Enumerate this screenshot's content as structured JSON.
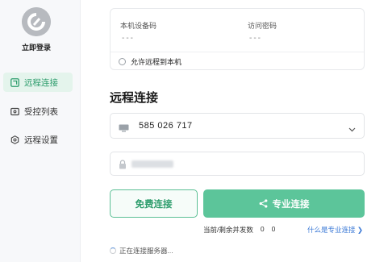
{
  "sidebar": {
    "login_label": "立即登录",
    "items": [
      {
        "label": "远程连接",
        "icon": "remote-connect-icon",
        "active": true
      },
      {
        "label": "受控列表",
        "icon": "controlled-list-icon",
        "active": false
      },
      {
        "label": "远程设置",
        "icon": "settings-icon",
        "active": false
      }
    ]
  },
  "device_card": {
    "device_code_label": "本机设备码",
    "device_code_value": "---",
    "access_password_label": "访问密码",
    "access_password_value": "---",
    "allow_remote_label": "允许远程到本机"
  },
  "main": {
    "title": "远程连接",
    "remote_id": "585 026 717",
    "free_connect_label": "免费连接",
    "pro_connect_label": "专业连接",
    "concurrency_label": "当前/剩余并发数",
    "concurrency_current": "0",
    "concurrency_remaining": "0",
    "pro_link_label": "什么是专业连接 ❯",
    "status_text": "正在连接服务器..."
  },
  "colors": {
    "accent": "#5cc59a",
    "accent_dark": "#2e9d6d",
    "link": "#3a78d6"
  }
}
